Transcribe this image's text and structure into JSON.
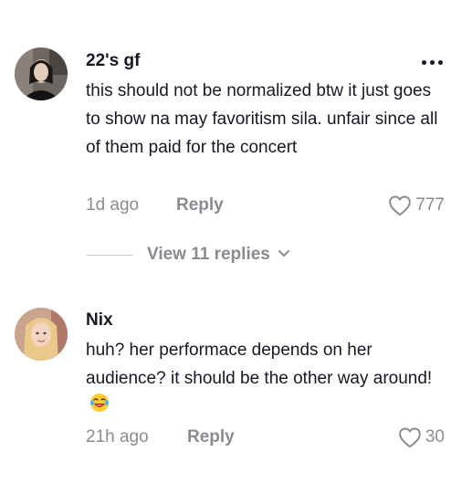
{
  "comments": [
    {
      "username": "22's gf",
      "text": "this should not be normalized btw it just goes to show na may favoritism sila. unfair since all of them paid for the concert",
      "time": "1d ago",
      "reply_label": "Reply",
      "likes": "777",
      "more_icon": "more-dots-icon",
      "like_icon": "heart-outline-icon"
    },
    {
      "username": "Nix",
      "text": "huh? her performace depends on her audience? it should be the other way around!",
      "emoji": "laughing-tears-emoji",
      "time": "21h ago",
      "reply_label": "Reply",
      "likes": "30",
      "like_icon": "heart-outline-icon"
    }
  ],
  "view_replies": {
    "label": "View 11 replies",
    "icon": "chevron-down-icon"
  }
}
